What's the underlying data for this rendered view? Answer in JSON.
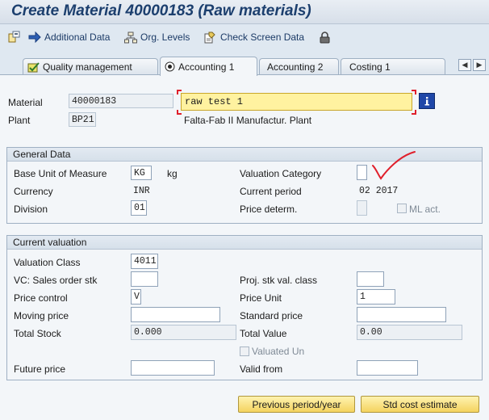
{
  "title": "Create Material 40000183 (Raw materials)",
  "toolbar": {
    "additional_data": "Additional Data",
    "org_levels": "Org. Levels",
    "check_screen_data": "Check Screen Data"
  },
  "tabs": [
    {
      "label": "Quality management"
    },
    {
      "label": "Accounting 1"
    },
    {
      "label": "Accounting 2"
    },
    {
      "label": "Costing 1"
    }
  ],
  "header": {
    "material_label": "Material",
    "material_value": "40000183",
    "material_desc": "raw test 1",
    "plant_label": "Plant",
    "plant_value": "BP21",
    "plant_desc": "Falta-Fab II Manufactur. Plant"
  },
  "general": {
    "title": "General Data",
    "base_uom_label": "Base Unit of Measure",
    "base_uom_value": "KG",
    "base_uom_text": "kg",
    "valuation_category_label": "Valuation Category",
    "valuation_category_value": "",
    "currency_label": "Currency",
    "currency_value": "INR",
    "current_period_label": "Current period",
    "current_period_value": "02 2017",
    "division_label": "Division",
    "division_value": "01",
    "price_determ_label": "Price determ.",
    "price_determ_value": "",
    "ml_act_label": "ML act."
  },
  "valuation": {
    "title": "Current valuation",
    "valuation_class_label": "Valuation Class",
    "valuation_class_value": "4011",
    "vc_sales_order_label": "VC: Sales order stk",
    "vc_sales_order_value": "",
    "proj_stk_label": "Proj. stk val. class",
    "proj_stk_value": "",
    "price_control_label": "Price control",
    "price_control_value": "V",
    "price_unit_label": "Price Unit",
    "price_unit_value": "1",
    "moving_price_label": "Moving price",
    "moving_price_value": "",
    "standard_price_label": "Standard price",
    "standard_price_value": "",
    "total_stock_label": "Total Stock",
    "total_stock_value": "0.000",
    "total_value_label": "Total Value",
    "total_value_value": "0.00",
    "valuated_un_label": "Valuated Un",
    "future_price_label": "Future price",
    "future_price_value": "",
    "valid_from_label": "Valid from",
    "valid_from_value": ""
  },
  "buttons": {
    "previous_period": "Previous period/year",
    "std_cost_estimate": "Std cost estimate"
  },
  "colors": {
    "title": "#1c3f6e",
    "accent_button": "#f4d35f",
    "annotation": "#e0202c"
  }
}
